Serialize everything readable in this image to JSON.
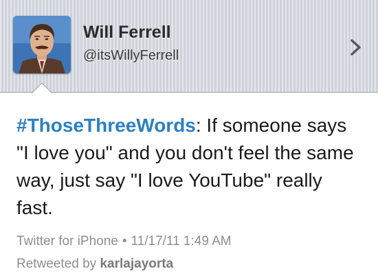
{
  "profile": {
    "name": "Will Ferrell",
    "handle": "@itsWillyFerrell"
  },
  "tweet": {
    "hashtag": "#ThoseThreeWords",
    "text": ": If someone says \"I love you\" and you don't feel the same way, just say \"I love YouTube\" really fast."
  },
  "meta": {
    "source": "Twitter for iPhone",
    "separator": "•",
    "timestamp": "11/17/11 1:49 AM"
  },
  "retweet": {
    "prefix": "Retweeted by",
    "user": "karlajayorta"
  },
  "icons": {
    "chevron": "chevron-right-icon",
    "avatar": "profile-photo"
  },
  "colors": {
    "hashtag": "#2b7fc4",
    "header_bg": "#d5d9e1",
    "meta_text": "#8e8e8e"
  }
}
